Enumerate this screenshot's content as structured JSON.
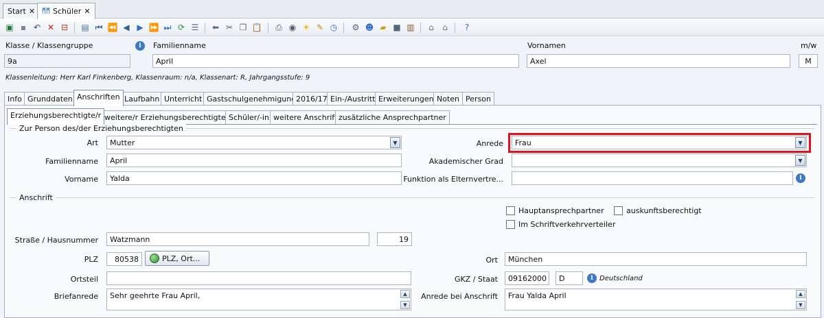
{
  "doc_tabs": [
    {
      "label": "Start",
      "close": "✕"
    },
    {
      "label": "Schüler",
      "close": "✕"
    }
  ],
  "toolbar_icons": [
    "new-icon",
    "save-icon",
    "undo-icon",
    "delete-icon",
    "cancel-icon",
    "copy-record-icon",
    "first-icon",
    "prev-page-icon",
    "prev-icon",
    "next-icon",
    "next-page-icon",
    "last-icon",
    "refresh-icon",
    "list-icon",
    "back-arrow-icon",
    "cut-icon",
    "copy-icon",
    "paste-icon",
    "print-icon",
    "preview-icon",
    "idea-icon",
    "marker-icon",
    "clock-icon",
    "module-icon",
    "user-icon",
    "folder-icon",
    "box-icon",
    "report-icon",
    "house-icon",
    "houses-icon",
    "help-icon"
  ],
  "header": {
    "klasse_label": "Klasse / Klassengruppe",
    "klasse_value": "9a",
    "familienname_label": "Familienname",
    "familienname_value": "April",
    "vornamen_label": "Vornamen",
    "vornamen_value": "Axel",
    "mw_label": "m/w",
    "mw_value": "M",
    "info_line": "Klassenleitung: Herr Karl Finkenberg, Klassenraum: n/a, Klassenart: R, Jahrgangsstufe: 9"
  },
  "main_tabs": [
    "Info",
    "Grunddaten",
    "Anschriften",
    "Laufbahn",
    "Unterricht",
    "Gastschulgenehmigung",
    "2016/17",
    "Ein-/Austritt",
    "Erweiterungen",
    "Noten",
    "Person"
  ],
  "sub_tabs": [
    "Erziehungsberechtigte/r",
    "weitere/r Erziehungsberechtigte/r",
    "Schüler/-in",
    "weitere Anschrift",
    "zusätzliche Ansprechpartner"
  ],
  "person_group": {
    "title": "Zur Person des/der Erziehungsberechtigten",
    "art_label": "Art",
    "art_value": "Mutter",
    "familienname_label": "Familienname",
    "familienname_value": "April",
    "vorname_label": "Vorname",
    "vorname_value": "Yalda",
    "anrede_label": "Anrede",
    "anrede_value": "Frau",
    "akad_label": "Akademischer Grad",
    "akad_value": "",
    "funktion_label": "Funktion als Elternvertre...",
    "funktion_value": ""
  },
  "anschrift_group": {
    "title": "Anschrift",
    "haupt_label": "Hauptansprechpartner",
    "auskunft_label": "auskunftsberechtigt",
    "schrift_label": "Im Schriftverkehrverteiler",
    "strasse_label": "Straße / Hausnummer",
    "strasse_value": "Watzmann",
    "hausnr_value": "19",
    "plz_label": "PLZ",
    "plz_value": "80538",
    "plz_button": "PLZ, Ort...",
    "ort_label": "Ort",
    "ort_value": "München",
    "ortsteil_label": "Ortsteil",
    "ortsteil_value": "",
    "gkz_label": "GKZ / Staat",
    "gkz_value": "09162000",
    "staat_value": "D",
    "staat_name": "Deutschland",
    "briefanrede_label": "Briefanrede",
    "briefanrede_value": "Sehr geehrte Frau April,",
    "anrede_anschrift_label": "Anrede bei Anschrift",
    "anrede_anschrift_value": "Frau Yalda April"
  },
  "colors": {
    "highlight": "#e3101a",
    "accent": "#3f79c4"
  }
}
